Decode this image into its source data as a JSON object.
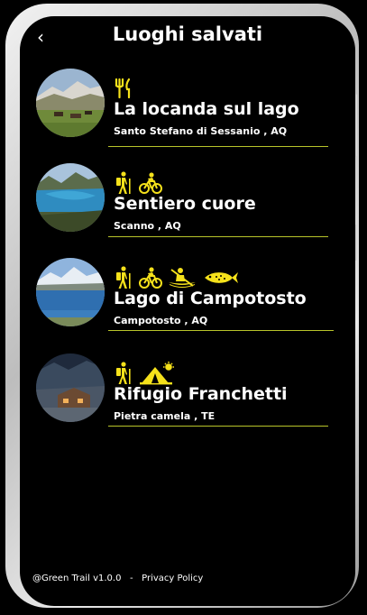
{
  "header": {
    "back_icon": "chevron-left-icon",
    "title": "Luoghi salvati"
  },
  "accent_color": "#F5E11B",
  "divider_color": "#B8C42A",
  "places": [
    {
      "name": "La locanda sul lago",
      "location": "Santo Stefano di Sessanio , AQ",
      "icons": [
        "restaurant-icon"
      ]
    },
    {
      "name": "Sentiero cuore",
      "location": "Scanno , AQ",
      "icons": [
        "hiking-icon",
        "mountain-bike-icon"
      ]
    },
    {
      "name": "Lago di Campotosto",
      "location": "Campotosto , AQ",
      "icons": [
        "hiking-icon",
        "mountain-bike-icon",
        "kayak-icon",
        "fish-icon"
      ]
    },
    {
      "name": "Rifugio Franchetti",
      "location": "Pietra camela , TE",
      "icons": [
        "hiking-icon",
        "camping-icon"
      ]
    }
  ],
  "footer": {
    "version": "@Green Trail v1.0.0",
    "separator": "-",
    "privacy": "Privacy Policy"
  }
}
